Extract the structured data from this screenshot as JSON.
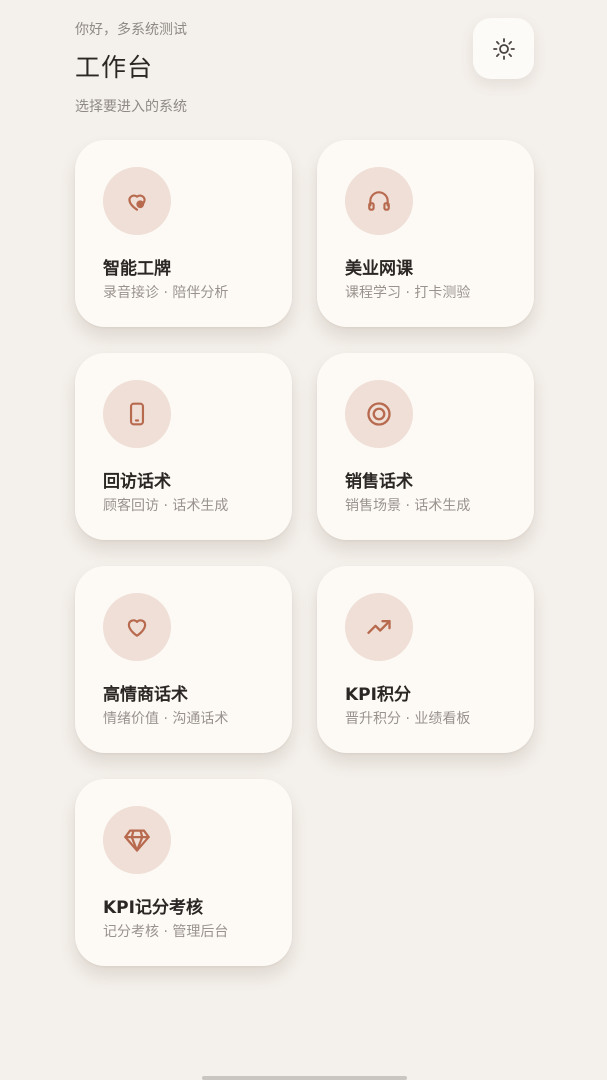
{
  "header": {
    "greeting": "你好，多系统测试",
    "title": "工作台",
    "subtitle": "选择要进入的系统",
    "settings_icon": "sun-icon"
  },
  "accent_color": "#b86a4f",
  "icon_bg_color": "#efdfd6",
  "cards": [
    {
      "title": "智能工牌",
      "subtitle": "录音接诊 · 陪伴分析",
      "icon": "badge-pin-icon"
    },
    {
      "title": "美业网课",
      "subtitle": "课程学习 · 打卡测验",
      "icon": "headphones-icon"
    },
    {
      "title": "回访话术",
      "subtitle": "顾客回访 · 话术生成",
      "icon": "phone-icon"
    },
    {
      "title": "销售话术",
      "subtitle": "销售场景 · 话术生成",
      "icon": "target-icon"
    },
    {
      "title": "高情商话术",
      "subtitle": "情绪价值 · 沟通话术",
      "icon": "heart-icon"
    },
    {
      "title": "KPI积分",
      "subtitle": "晋升积分 · 业绩看板",
      "icon": "trending-up-icon"
    },
    {
      "title": "KPI记分考核",
      "subtitle": "记分考核 · 管理后台",
      "icon": "diamond-icon"
    }
  ]
}
